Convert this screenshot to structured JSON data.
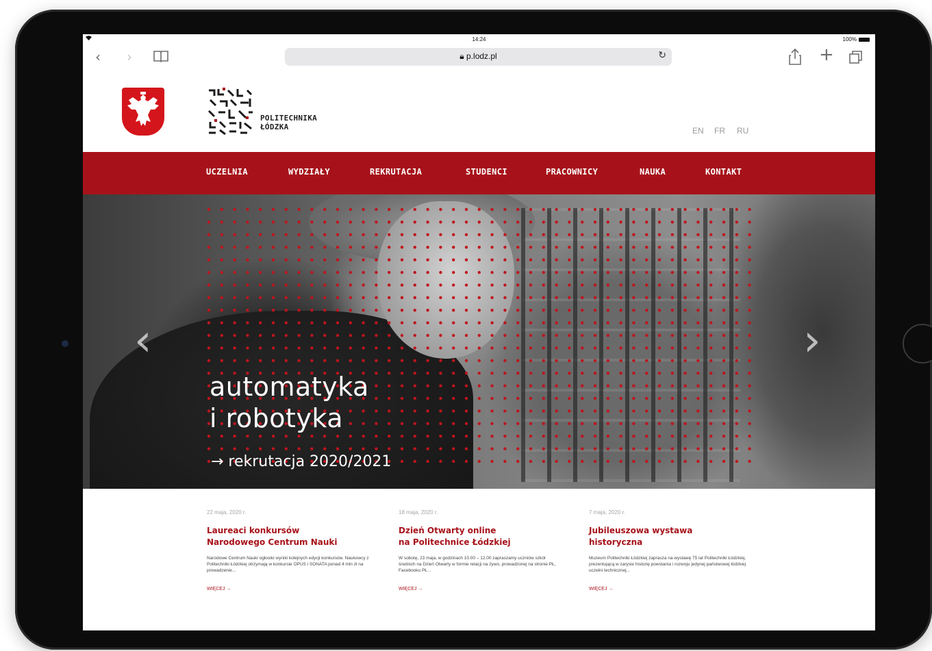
{
  "status_bar": {
    "time": "14:24",
    "battery": "100%"
  },
  "browser": {
    "url": "p.lodz.pl",
    "back_icon": "‹",
    "forward_icon": "›",
    "bookmarks_icon": "book-icon",
    "reload_icon": "↻",
    "share_icon": "share-icon",
    "new_tab_icon": "+",
    "tabs_icon": "tabs-icon"
  },
  "header": {
    "logo_line1": "POLITECHNIKA",
    "logo_line2": "ŁÓDZKA",
    "languages": [
      "EN",
      "FR",
      "RU"
    ]
  },
  "nav": {
    "items": [
      "UCZELNIA",
      "WYDZIAŁY",
      "REKRUTACJA",
      "STUDENCI",
      "PRACOWNICY",
      "NAUKA",
      "KONTAKT"
    ]
  },
  "hero": {
    "title_line1": "automatyka",
    "title_line2": "i robotyka",
    "link": "→ rekrutacja 2020/2021",
    "prev_arrow": "‹",
    "next_arrow": "›"
  },
  "news": [
    {
      "date": "22 maja, 2020 r.",
      "title_line1": "Laureaci konkursów",
      "title_line2": "Narodowego Centrum Nauki",
      "body": "Narodowe Centrum Nauki ogłosiło wyniki kolejnych edycji konkursów. Naukowcy z Politechniki Łódzkiej otrzymają w konkursie OPUS i SONATA ponad 4 mln zł na prowadzenie...",
      "more": "WIĘCEJ →"
    },
    {
      "date": "18 maja, 2020 r.",
      "title_line1": "Dzień Otwarty online",
      "title_line2": "na Politechnice Łódzkiej",
      "body": "W sobotę, 23 maja, w godzinach 10.00 – 12.00 zapraszamy uczniów szkół średnich na Dzień Otwarty w formie relacji na żywo, prowadzonej na stronie PŁ, Facebooku PŁ...",
      "more": "WIĘCEJ →"
    },
    {
      "date": "7 maja, 2020 r.",
      "title_line1": "Jubileuszowa wystawa",
      "title_line2": "historyczna",
      "body": "Muzeum Politechniki Łódzkiej zaprasza na wystawę 75 lat Politechniki Łódzkiej, prezentującą w zarysie historię powstania i rozwoju jedynej państwowej łódzkiej uczelni technicznej...",
      "more": "WIĘCEJ →"
    }
  ],
  "colors": {
    "brand_red": "#a7121a",
    "emblem_red": "#d4151b",
    "dot_red": "#c0141c"
  }
}
